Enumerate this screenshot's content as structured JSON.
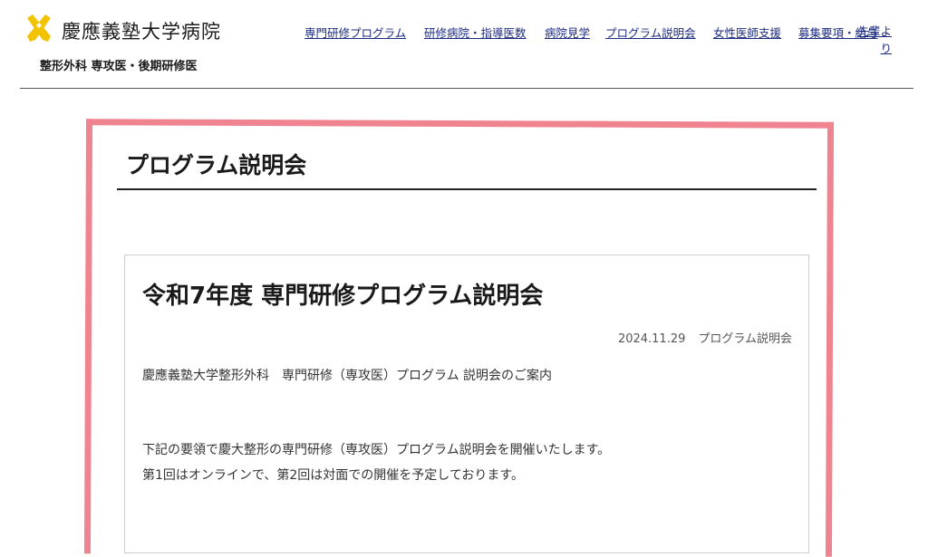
{
  "header": {
    "hospital_name": "慶應義塾大学病院",
    "department": "整形外科 専攻医・後期研修医",
    "logo_icon": "pen-cross-logo-icon",
    "logo_color": "#f2c300"
  },
  "nav": {
    "items": [
      {
        "label": "専門研修プログラム"
      },
      {
        "label": "研修病院・指導医数"
      },
      {
        "label": "病院見学"
      },
      {
        "label": "プログラム説明会"
      },
      {
        "label": "女性医師支援"
      },
      {
        "label": "募集要項・給与"
      },
      {
        "label": "先輩より"
      }
    ],
    "link_color": "#1c2b80"
  },
  "page": {
    "title": "プログラム説明会",
    "highlight_color": "#ef8490"
  },
  "article": {
    "title": "令和7年度 専門研修プログラム説明会",
    "date": "2024.11.29",
    "category": "プログラム説明会",
    "paragraphs": [
      "慶應義塾大学整形外科　専門研修（専攻医）プログラム  説明会のご案内",
      "下記の要領で慶大整形の専門研修（専攻医）プログラム説明会を開催いたします。",
      "第1回はオンラインで、第2回は対面での開催を予定しております。"
    ]
  }
}
